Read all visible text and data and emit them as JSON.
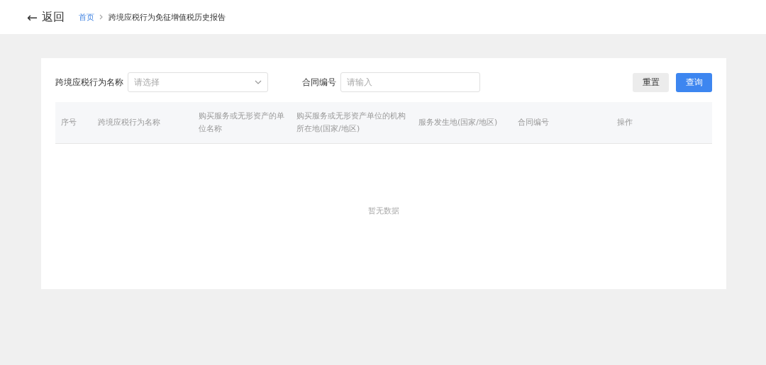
{
  "header": {
    "back_arrow": "←",
    "back_label": "返回",
    "breadcrumb": [
      {
        "label": "首页",
        "kind": "link"
      },
      {
        "label": "跨境应税行为免征增值税历史报告",
        "kind": "current"
      }
    ]
  },
  "filters": [
    {
      "label": "跨境应税行为名称",
      "kind": "select",
      "placeholder": "请选择"
    },
    {
      "label": "合同编号",
      "kind": "input",
      "placeholder": "请输入"
    }
  ],
  "buttons": [
    {
      "label": "重置",
      "kind": "secondary"
    },
    {
      "label": "查询",
      "kind": "primary"
    }
  ],
  "table": {
    "columns": [
      "序号",
      "跨境应税行为名称",
      "购买服务或无形资产的单位名称",
      "购买服务或无形资产单位的机构所在地(国家/地区)",
      "服务发生地(国家/地区)",
      "合同编号",
      "操作"
    ],
    "empty_text": "暂无数据"
  }
}
